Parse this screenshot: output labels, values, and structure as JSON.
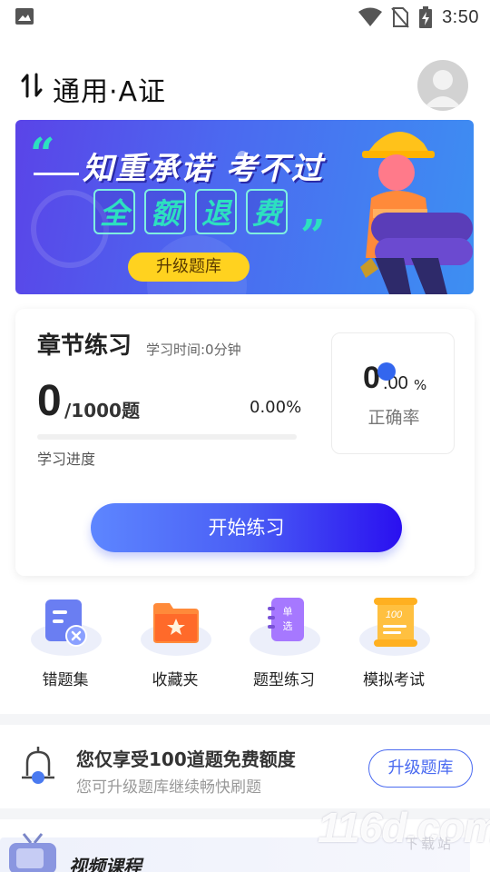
{
  "status_bar": {
    "time": "3:50",
    "icons": [
      "image-icon",
      "wifi-icon",
      "no-sim-icon",
      "battery-charging-icon"
    ]
  },
  "header": {
    "title": "通用·A证",
    "switch_icon": "switch-arrows-icon",
    "avatar_icon": "user-avatar-icon"
  },
  "banner": {
    "line1": "知重承诺 考不过",
    "line2": [
      "全",
      "额",
      "退",
      "费"
    ],
    "button_label": "升级题库"
  },
  "chapter_card": {
    "title": "章节练习",
    "study_time": "学习时间:0分钟",
    "done_count": "0",
    "total": "/1000题",
    "percent": "0.00%",
    "progress_fraction": 0,
    "progress_label": "学习进度",
    "accuracy_int": "0",
    "accuracy_dec": ".00",
    "accuracy_unit": "%",
    "accuracy_label": "正确率",
    "start_button": "开始练习"
  },
  "actions": [
    {
      "label": "错题集",
      "icon": "wrong-questions-icon"
    },
    {
      "label": "收藏夹",
      "icon": "favorites-folder-icon"
    },
    {
      "label": "题型练习",
      "icon": "question-type-icon"
    },
    {
      "label": "模拟考试",
      "icon": "mock-exam-icon"
    }
  ],
  "quota": {
    "title": "您仅享受100道题免费额度",
    "subtitle": "您可升级题库继续畅快刷题",
    "button": "升级题库"
  },
  "video_section": {
    "title": "视频课程"
  },
  "watermark": {
    "text": "116d.com",
    "sub": "下载站"
  },
  "colors": {
    "accent": "#4a6af0",
    "banner_yellow": "#ffd21f",
    "banner_teal": "#2de0c0"
  }
}
